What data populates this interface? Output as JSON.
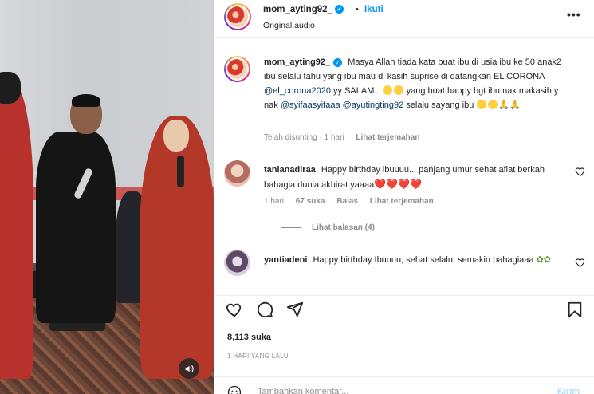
{
  "post": {
    "username": "mom_ayting92_",
    "dot": "•",
    "follow_label": "Ikuti",
    "audio_label": "Original audio",
    "more_label": "•••"
  },
  "caption": {
    "username": "mom_ayting92_",
    "text_1": "Masya Allah tiada kata buat ibu di usia ibu ke 50 anak2 ibu selalu tahu yang ibu mau di kasih suprise di datangkan EL CORONA",
    "mention_1": "@el_corona2020",
    "text_2": "yy SALAM...",
    "text_3": "yang buat happy bgt ibu nak makasih y nak",
    "mention_2": "@syifaasyifaaa",
    "mention_3": "@ayutingting92",
    "text_4": "selalu sayang ibu",
    "meta_edited": "Telah disunting · 1 hari",
    "meta_translate": "Lihat terjemahan"
  },
  "comments": [
    {
      "username": "tanianadiraa",
      "text": "Happy birthday ibuuuu... panjang umur sehat afiat berkah bahagia dunia akhirat yaaaa",
      "time": "1 hari",
      "likes": "67 suka",
      "reply": "Balas",
      "translate": "Lihat terjemahan",
      "replies_label": "Lihat balasan (4)"
    },
    {
      "username": "yantiadeni",
      "text": "Happy birthday Ibuuuu, sehat selalu, semakin bahagiaaa"
    }
  ],
  "actions": {
    "likes": "8,113 suka",
    "time_ago": "1 HARI YANG LALU",
    "comment_placeholder": "Tambahkan komentar...",
    "post_label": "Kirim"
  },
  "icons": {
    "header": [
      "verified-icon",
      "more-icon"
    ],
    "actions": [
      "heart-icon",
      "comment-icon",
      "share-icon",
      "bookmark-icon",
      "emoji-icon",
      "audio-icon"
    ]
  },
  "colors": {
    "accent": "#0095f6",
    "mention": "#00376b",
    "muted": "#8e8e8e",
    "heart": "#e0245e"
  }
}
